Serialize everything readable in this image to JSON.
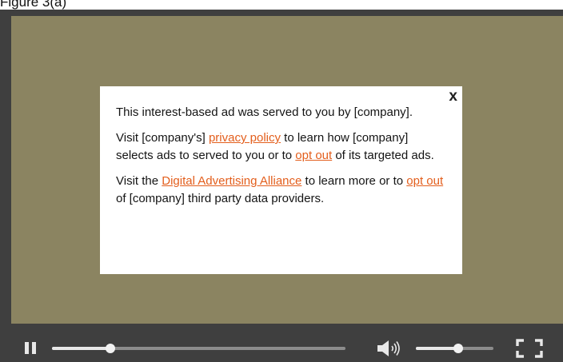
{
  "caption": "Figure 3(a)",
  "player": {
    "video_bg_color": "#8b8461",
    "controls_bg_color": "#3f3f3f"
  },
  "modal": {
    "close_label": "x",
    "p1": "This interest-based ad was served to you by [company].",
    "p2_before": "Visit [company's] ",
    "p2_link1": "privacy policy",
    "p2_middle": " to learn how [company] selects ads to served to you or to ",
    "p2_link2": "opt out",
    "p2_after": " of its targeted ads.",
    "p3_before": "Visit the ",
    "p3_link1": "Digital Advertising Alliance",
    "p3_middle": " to learn more or to ",
    "p3_link2": "opt out",
    "p3_after": " of [company] third party data providers.",
    "link_color": "#e35e1c"
  },
  "controls": {
    "play_state": "playing",
    "pause_icon": "pause-icon",
    "progress_fraction": 0.2,
    "volume_icon": "volume-icon",
    "volume_fraction": 0.55,
    "fullscreen_icon": "fullscreen-icon"
  }
}
